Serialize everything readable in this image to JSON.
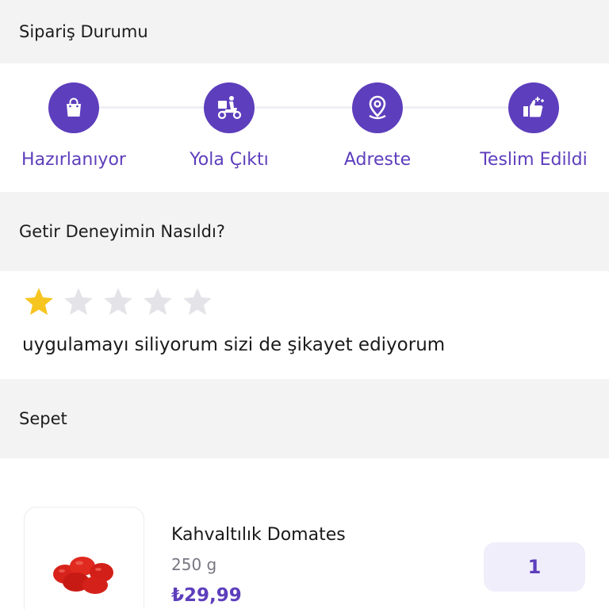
{
  "order_status": {
    "title": "Sipariş Durumu",
    "steps": [
      {
        "label": "Hazırlanıyor",
        "icon": "shopping-bag-icon"
      },
      {
        "label": "Yola Çıktı",
        "icon": "delivery-scooter-icon"
      },
      {
        "label": "Adreste",
        "icon": "location-pin-icon"
      },
      {
        "label": "Teslim Edildi",
        "icon": "thumbs-up-icon"
      }
    ],
    "accent_color": "#5d3ebc"
  },
  "rating": {
    "title": "Getir Deneyimin Nasıldı?",
    "value": 1,
    "max": 5,
    "comment": "uygulamayı siliyorum sizi de şikayet ediyorum",
    "star_filled_color": "#f7c520",
    "star_empty_color": "#e4e4e8"
  },
  "cart": {
    "title": "Sepet",
    "items": [
      {
        "name": "Kahvaltılık Domates",
        "unit": "250 g",
        "price": "₺29,99",
        "quantity": "1",
        "image": "cherry-tomatoes-image"
      }
    ]
  }
}
